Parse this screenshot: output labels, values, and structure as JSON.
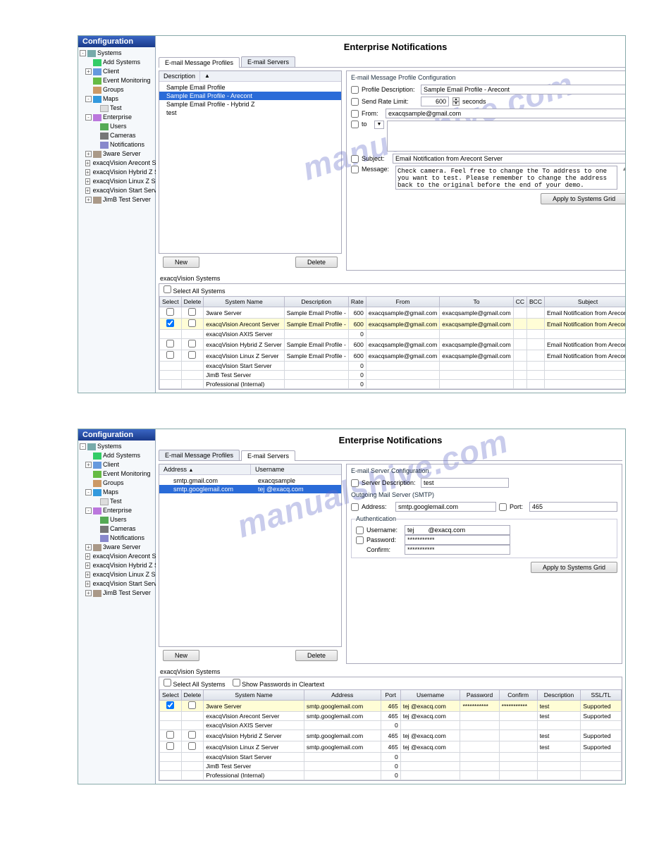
{
  "watermark": "manualshive.com",
  "sidebar": {
    "title": "Configuration",
    "items": [
      {
        "label": "Systems",
        "icon": "system",
        "exp": "-",
        "lvl": 0
      },
      {
        "label": "Add Systems",
        "icon": "add",
        "lvl": 1
      },
      {
        "label": "Client",
        "icon": "client",
        "exp": "+",
        "lvl": 1
      },
      {
        "label": "Event Monitoring",
        "icon": "mon",
        "lvl": 1
      },
      {
        "label": "Groups",
        "icon": "group",
        "lvl": 1
      },
      {
        "label": "Maps",
        "icon": "maps",
        "exp": "-",
        "lvl": 1
      },
      {
        "label": "Test",
        "icon": "page",
        "lvl": 2
      },
      {
        "label": "Enterprise",
        "icon": "ent",
        "exp": "-",
        "lvl": 1
      },
      {
        "label": "Users",
        "icon": "users",
        "lvl": 2
      },
      {
        "label": "Cameras",
        "icon": "cam",
        "lvl": 2
      },
      {
        "label": "Notifications",
        "icon": "notif",
        "lvl": 2
      },
      {
        "label": "3ware Server",
        "icon": "srv",
        "exp": "+",
        "lvl": 1
      },
      {
        "label": "exacqVision Arecont Server",
        "icon": "srv2",
        "exp": "+",
        "lvl": 1
      },
      {
        "label": "exacqVision Hybrid Z Server",
        "icon": "srv2",
        "exp": "+",
        "lvl": 1
      },
      {
        "label": "exacqVision Linux Z Server",
        "icon": "srv2",
        "exp": "+",
        "lvl": 1
      },
      {
        "label": "exacqVision Start Server",
        "icon": "srv2",
        "exp": "+",
        "lvl": 1
      },
      {
        "label": "JimB Test Server",
        "icon": "srv",
        "exp": "+",
        "lvl": 1
      }
    ]
  },
  "page1": {
    "title": "Enterprise Notifications",
    "tab1": "E-mail Message Profiles",
    "tab2": "E-mail Servers",
    "list_header": "Description",
    "profiles": [
      "Sample Email Profile",
      "Sample Email Profile - Arecont",
      "Sample Email Profile - Hybrid Z",
      "test"
    ],
    "selected_profile_index": 1,
    "btn_new": "New",
    "btn_delete": "Delete",
    "config": {
      "title": "E-mail Message Profile Configuration",
      "profile_desc_label": "Profile Description:",
      "profile_desc": "Sample Email Profile - Arecont",
      "send_rate_label": "Send Rate Limit:",
      "send_rate_value": "600",
      "send_rate_unit": "seconds",
      "from_label": "From:",
      "from_value": "exacqsample@gmail.com",
      "to_label": "to",
      "subject_label": "Subject:",
      "subject_value": "Email Notification from Arecont Server",
      "message_label": "Message:",
      "message_value": "Check camera. Feel free to change the To address to one you want to test. Please remember to change the address back to the original before the end of your demo.",
      "apply_btn": "Apply to Systems Grid"
    },
    "systems_label": "exacqVision Systems",
    "select_all": "Select All Systems",
    "grid_headers": [
      "Select",
      "Delete",
      "System Name",
      "Description",
      "Rate",
      "From",
      "To",
      "CC",
      "BCC",
      "Subject"
    ],
    "grid_rows": [
      {
        "sel": false,
        "del": false,
        "name": "3ware Server",
        "desc": "Sample Email Profile -",
        "rate": "600",
        "from": "exacqsample@gmail.com",
        "to": "exacqsample@gmail.com",
        "cc": "",
        "bcc": "",
        "subj": "Email Notification from Arecont"
      },
      {
        "sel": true,
        "del": false,
        "name": "exacqVision Arecont Server",
        "desc": "Sample Email Profile -",
        "rate": "600",
        "from": "exacqsample@gmail.com",
        "to": "exacqsample@gmail.com",
        "cc": "",
        "bcc": "",
        "subj": "Email Notification from Arecont",
        "hl": true
      },
      {
        "sel": null,
        "del": null,
        "name": "exacqVision AXIS Server",
        "desc": "",
        "rate": "0",
        "from": "",
        "to": "",
        "cc": "",
        "bcc": "",
        "subj": ""
      },
      {
        "sel": false,
        "del": false,
        "name": "exacqVision Hybrid Z Server",
        "desc": "Sample Email Profile -",
        "rate": "600",
        "from": "exacqsample@gmail.com",
        "to": "exacqsample@gmail.com",
        "cc": "",
        "bcc": "",
        "subj": "Email Notification from Arecont"
      },
      {
        "sel": false,
        "del": false,
        "name": "exacqVision Linux Z Server",
        "desc": "Sample Email Profile -",
        "rate": "600",
        "from": "exacqsample@gmail.com",
        "to": "exacqsample@gmail.com",
        "cc": "",
        "bcc": "",
        "subj": "Email Notification from Arecont"
      },
      {
        "sel": null,
        "del": null,
        "name": "exacqVision Start Server",
        "desc": "",
        "rate": "0",
        "from": "",
        "to": "",
        "cc": "",
        "bcc": "",
        "subj": ""
      },
      {
        "sel": null,
        "del": null,
        "name": "JimB Test Server",
        "desc": "",
        "rate": "0",
        "from": "",
        "to": "",
        "cc": "",
        "bcc": "",
        "subj": ""
      },
      {
        "sel": null,
        "del": null,
        "name": "Professional (Internal)",
        "desc": "",
        "rate": "0",
        "from": "",
        "to": "",
        "cc": "",
        "bcc": "",
        "subj": ""
      }
    ]
  },
  "page2": {
    "title": "Enterprise Notifications",
    "tab1": "E-mail Message Profiles",
    "tab2": "E-mail Servers",
    "list_headers": [
      "Address",
      "Username"
    ],
    "servers": [
      {
        "addr": "smtp.gmail.com",
        "user": "exacqsample"
      },
      {
        "addr": "smtp.googlemail.com",
        "user": "tej        @exacq.com"
      }
    ],
    "selected_server_index": 1,
    "btn_new": "New",
    "btn_delete": "Delete",
    "config": {
      "title": "E-mail Server Configuration",
      "server_desc_label": "Server Description:",
      "server_desc": "test",
      "smtp_label": "Outgoing Mail Server (SMTP)",
      "address_label": "Address:",
      "address_value": "smtp.googlemail.com",
      "port_label": "Port:",
      "port_value": "465",
      "auth_label": "Authentication",
      "username_label": "Username:",
      "username_value": "tej        @exacq.com",
      "password_label": "Password:",
      "password_value": "***********",
      "confirm_label": "Confirm:",
      "confirm_value": "***********",
      "apply_btn": "Apply to Systems Grid"
    },
    "systems_label": "exacqVision Systems",
    "select_all": "Select All Systems",
    "show_passwords": "Show Passwords in Cleartext",
    "grid_headers": [
      "Select",
      "Delete",
      "System Name",
      "Address",
      "Port",
      "Username",
      "Password",
      "Confirm",
      "Description",
      "SSL/TL"
    ],
    "grid_rows": [
      {
        "sel": true,
        "del": false,
        "name": "3ware Server",
        "addr": "smtp.googlemail.com",
        "port": "465",
        "user": "tej       @exacq.com",
        "pass": "***********",
        "conf": "***********",
        "desc": "test",
        "ssl": "Supported",
        "hl": true
      },
      {
        "sel": null,
        "del": null,
        "name": "exacqVision Arecont Server",
        "addr": "smtp.googlemail.com",
        "port": "465",
        "user": "tej       @exacq.com",
        "pass": "",
        "conf": "",
        "desc": "test",
        "ssl": "Supported"
      },
      {
        "sel": null,
        "del": null,
        "name": "exacqVision AXIS Server",
        "addr": "",
        "port": "0",
        "user": "",
        "pass": "",
        "conf": "",
        "desc": "",
        "ssl": ""
      },
      {
        "sel": false,
        "del": false,
        "name": "exacqVision Hybrid Z Server",
        "addr": "smtp.googlemail.com",
        "port": "465",
        "user": "tej       @exacq.com",
        "pass": "",
        "conf": "",
        "desc": "test",
        "ssl": "Supported"
      },
      {
        "sel": false,
        "del": false,
        "name": "exacqVision Linux Z Server",
        "addr": "smtp.googlemail.com",
        "port": "465",
        "user": "tej       @exacq.com",
        "pass": "",
        "conf": "",
        "desc": "test",
        "ssl": "Supported"
      },
      {
        "sel": null,
        "del": null,
        "name": "exacqVision Start Server",
        "addr": "",
        "port": "0",
        "user": "",
        "pass": "",
        "conf": "",
        "desc": "",
        "ssl": ""
      },
      {
        "sel": null,
        "del": null,
        "name": "JimB Test Server",
        "addr": "",
        "port": "0",
        "user": "",
        "pass": "",
        "conf": "",
        "desc": "",
        "ssl": ""
      },
      {
        "sel": null,
        "del": null,
        "name": "Professional (Internal)",
        "addr": "",
        "port": "0",
        "user": "",
        "pass": "",
        "conf": "",
        "desc": "",
        "ssl": ""
      }
    ]
  }
}
